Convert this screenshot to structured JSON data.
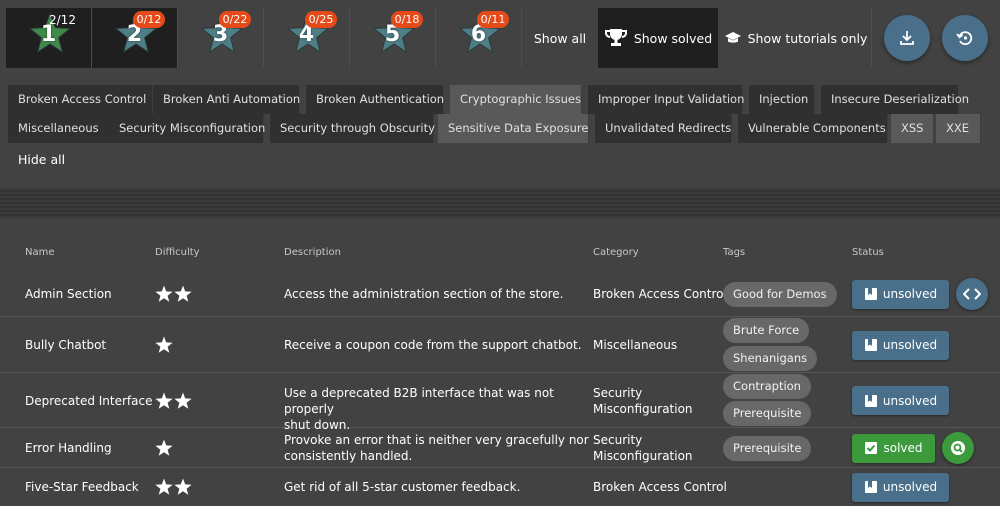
{
  "difficulty_stars": [
    {
      "level": "1",
      "badge": "2/12",
      "badge_style": "plain",
      "active": true
    },
    {
      "level": "2",
      "badge": "0/12",
      "badge_style": "red",
      "active": true
    },
    {
      "level": "3",
      "badge": "0/22",
      "badge_style": "red",
      "active": false
    },
    {
      "level": "4",
      "badge": "0/25",
      "badge_style": "red",
      "active": false
    },
    {
      "level": "5",
      "badge": "0/18",
      "badge_style": "red",
      "active": false
    },
    {
      "level": "6",
      "badge": "0/11",
      "badge_style": "red",
      "active": false
    }
  ],
  "filters": {
    "show_all": "Show all",
    "show_solved": "Show solved",
    "show_tutorials": "Show tutorials only"
  },
  "categories": [
    {
      "label": "Broken Access Control",
      "selected": false
    },
    {
      "label": "Broken Anti Automation",
      "selected": false
    },
    {
      "label": "Broken Authentication",
      "selected": false
    },
    {
      "label": "Cryptographic Issues",
      "selected": true
    },
    {
      "label": "Improper Input Validation",
      "selected": false
    },
    {
      "label": "Injection",
      "selected": false
    },
    {
      "label": "Insecure Deserialization",
      "selected": false
    },
    {
      "label": "Miscellaneous",
      "selected": false
    },
    {
      "label": "Security Misconfiguration",
      "selected": false
    },
    {
      "label": "Security through Obscurity",
      "selected": false
    },
    {
      "label": "Sensitive Data Exposure",
      "selected": true
    },
    {
      "label": "Unvalidated Redirects",
      "selected": false
    },
    {
      "label": "Vulnerable Components",
      "selected": false
    },
    {
      "label": "XSS",
      "selected": true
    },
    {
      "label": "XXE",
      "selected": true
    }
  ],
  "hide_all": "Hide all",
  "table": {
    "headers": {
      "name": "Name",
      "difficulty": "Difficulty",
      "description": "Description",
      "category": "Category",
      "tags": "Tags",
      "status": "Status"
    },
    "rows": [
      {
        "name": "Admin Section",
        "stars": 2,
        "description": [
          "Access the administration section of the store."
        ],
        "category": [
          "Broken Access Control"
        ],
        "tags": [
          "Good for Demos"
        ],
        "status": "unsolved",
        "solved": false,
        "extra": "code"
      },
      {
        "name": "Bully Chatbot",
        "stars": 1,
        "description": [
          "Receive a coupon code from the support chatbot."
        ],
        "category": [
          "Miscellaneous"
        ],
        "tags": [
          "Brute Force",
          "Shenanigans"
        ],
        "status": "unsolved",
        "solved": false,
        "extra": ""
      },
      {
        "name": "Deprecated Interface",
        "stars": 2,
        "description": [
          "Use a deprecated B2B interface that was not properly",
          "shut down."
        ],
        "category": [
          "Security",
          "Misconfiguration"
        ],
        "tags": [
          "Contraption",
          "Prerequisite"
        ],
        "status": "unsolved",
        "solved": false,
        "extra": ""
      },
      {
        "name": "Error Handling",
        "stars": 1,
        "description": [
          "Provoke an error that is neither very gracefully nor",
          "consistently handled."
        ],
        "category": [
          "Security",
          "Misconfiguration"
        ],
        "tags": [
          "Prerequisite"
        ],
        "status": "solved",
        "solved": true,
        "extra": "hint"
      },
      {
        "name": "Five-Star Feedback",
        "stars": 2,
        "description": [
          "Get rid of all 5-star customer feedback."
        ],
        "category": [
          "Broken Access Control"
        ],
        "tags": [],
        "status": "unsolved",
        "solved": false,
        "extra": ""
      }
    ]
  },
  "colors": {
    "accent_blue": "#4a6f8a",
    "solved_green": "#3c9a3c",
    "badge_red": "#e64a19",
    "star_teal": "#4f7f86"
  }
}
